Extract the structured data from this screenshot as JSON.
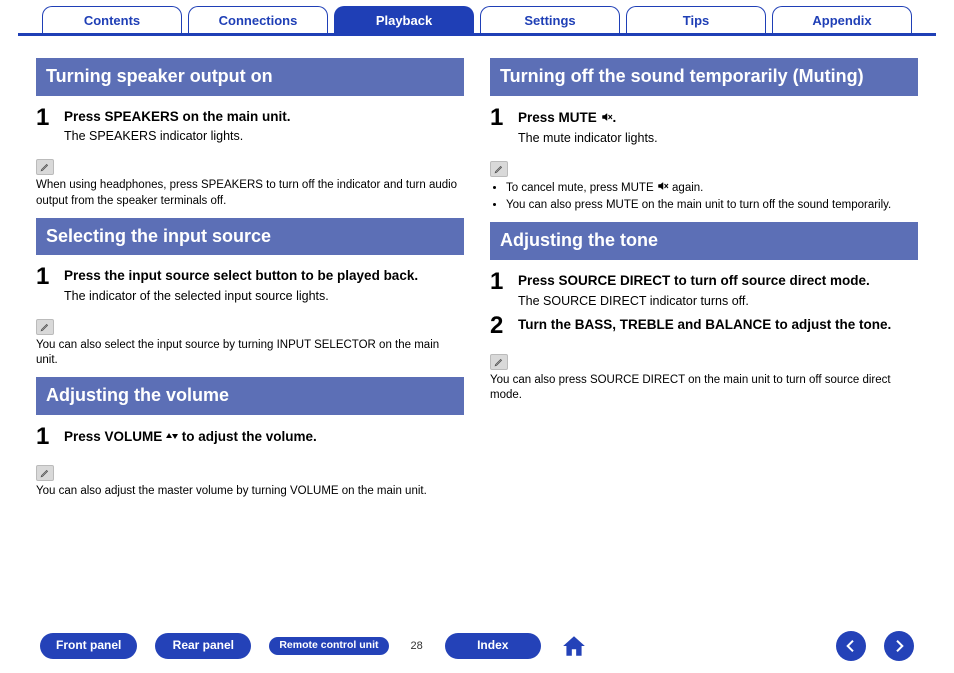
{
  "tabs": {
    "items": [
      "Contents",
      "Connections",
      "Playback",
      "Settings",
      "Tips",
      "Appendix"
    ],
    "active_index": 2
  },
  "left": {
    "s1": {
      "heading": "Turning speaker output on",
      "step1_num": "1",
      "step1_title": "Press SPEAKERS on the main unit.",
      "step1_desc": "The SPEAKERS indicator lights.",
      "note": "When using headphones, press SPEAKERS to turn off the indicator and turn audio output from the speaker terminals off."
    },
    "s2": {
      "heading": "Selecting the input source",
      "step1_num": "1",
      "step1_title": "Press the input source select button to be played back.",
      "step1_desc": "The indicator of the selected input source lights.",
      "note": "You can also select the input source by turning INPUT SELECTOR on the main unit."
    },
    "s3": {
      "heading": "Adjusting the volume",
      "step1_num": "1",
      "step1_title_pre": "Press VOLUME ",
      "step1_title_post": " to adjust the volume.",
      "note": "You can also adjust the master volume by turning VOLUME on the main unit."
    }
  },
  "right": {
    "s1": {
      "heading": "Turning off the sound temporarily (Muting)",
      "step1_num": "1",
      "step1_title_pre": "Press MUTE ",
      "step1_title_post": ".",
      "step1_desc": "The mute indicator lights.",
      "bullet1_pre": "To cancel mute, press MUTE ",
      "bullet1_post": " again.",
      "bullet2": "You can also press MUTE on the main unit to turn off the sound temporarily."
    },
    "s2": {
      "heading": "Adjusting the tone",
      "step1_num": "1",
      "step1_title": "Press SOURCE DIRECT to turn off source direct mode.",
      "step1_desc": "The SOURCE DIRECT indicator turns off.",
      "step2_num": "2",
      "step2_title": "Turn the BASS, TREBLE and BALANCE to adjust the tone.",
      "note": "You can also press SOURCE DIRECT on the main unit to turn off source direct mode."
    }
  },
  "bottom": {
    "front": "Front panel",
    "rear": "Rear panel",
    "remote": "Remote control unit",
    "index": "Index",
    "page": "28"
  }
}
